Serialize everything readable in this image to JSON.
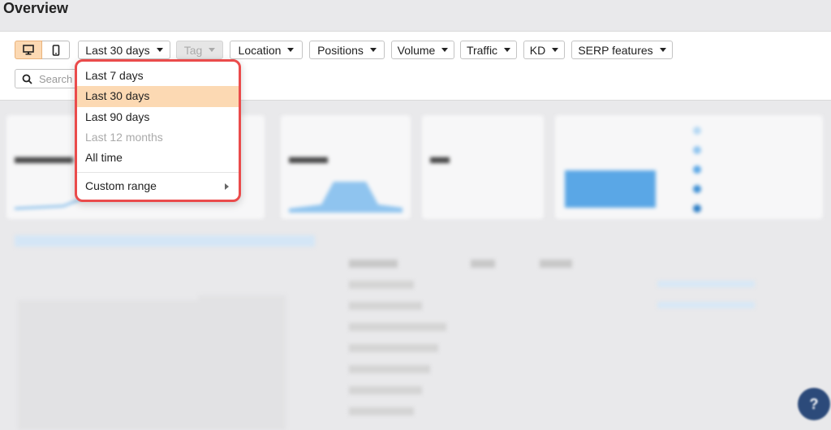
{
  "page": {
    "title": "Overview"
  },
  "toolbar": {
    "device_desktop_icon": "desktop-icon",
    "device_mobile_icon": "mobile-icon",
    "date_range": "Last 30 days",
    "filters": [
      "Tag",
      "Location",
      "Positions",
      "Volume",
      "Traffic",
      "KD",
      "SERP features"
    ],
    "search_placeholder": "Search"
  },
  "date_menu": {
    "items": [
      {
        "label": "Last 7 days",
        "state": "normal"
      },
      {
        "label": "Last 30 days",
        "state": "selected"
      },
      {
        "label": "Last 90 days",
        "state": "normal"
      },
      {
        "label": "Last 12 months",
        "state": "disabled"
      },
      {
        "label": "All time",
        "state": "normal"
      }
    ],
    "custom_range": "Custom range"
  },
  "colors": {
    "accent": "#fcd9b3",
    "highlight_border": "#ea4b4b",
    "help_button": "#2c4a7a"
  }
}
